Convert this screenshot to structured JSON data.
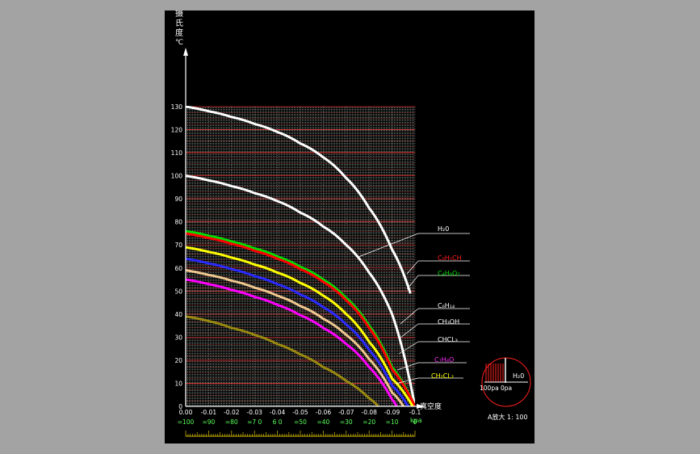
{
  "chart_data": {
    "type": "line",
    "title": "",
    "ylabel": "摄氏度 ℃",
    "xlabel": "真空度",
    "x_unit": "kpa",
    "xlim": [
      0,
      -0.1
    ],
    "ylim": [
      0,
      130
    ],
    "x_ticks": [
      "0.00",
      "-0.01",
      "-0.02",
      "-0.03",
      "-0.04",
      "-0.05",
      "-0.06",
      "-0.07",
      "-0.08",
      "-0.09",
      "-0.1"
    ],
    "x_ticks_secondary": [
      "=100",
      "=90",
      "=80",
      "≈7 0",
      "6 0",
      "=50",
      "=40",
      "=30",
      "=20",
      "=10",
      "0"
    ],
    "y_ticks": [
      "0",
      "10",
      "20",
      "30",
      "40",
      "50",
      "60",
      "70",
      "80",
      "90",
      "100",
      "110",
      "120",
      "130"
    ],
    "grid": true,
    "series": [
      {
        "name": "H2O",
        "label_text": "H₂0",
        "color": "#ffffff",
        "points": [
          [
            0,
            100
          ],
          [
            -0.01,
            98
          ],
          [
            -0.02,
            95.5
          ],
          [
            -0.03,
            92.5
          ],
          [
            -0.04,
            89
          ],
          [
            -0.05,
            84
          ],
          [
            -0.06,
            78
          ],
          [
            -0.07,
            70
          ],
          [
            -0.08,
            58
          ],
          [
            -0.09,
            40
          ],
          [
            -0.1,
            0
          ]
        ]
      },
      {
        "name": "C6H5CH",
        "label_text": "C₆H₅CH",
        "color": "#ffffff",
        "points": [
          [
            0,
            130
          ],
          [
            -0.01,
            128
          ],
          [
            -0.02,
            125.5
          ],
          [
            -0.03,
            122.5
          ],
          [
            -0.04,
            119
          ],
          [
            -0.05,
            114
          ],
          [
            -0.06,
            108
          ],
          [
            -0.07,
            99
          ],
          [
            -0.08,
            86
          ],
          [
            -0.09,
            68
          ],
          [
            -0.098,
            49
          ]
        ]
      },
      {
        "name": "C4H8O2",
        "label_text": "C₄H₈O₂",
        "color": "#00e000",
        "points": [
          [
            0,
            76
          ],
          [
            -0.01,
            74
          ],
          [
            -0.02,
            71.5
          ],
          [
            -0.03,
            68.5
          ],
          [
            -0.04,
            65
          ],
          [
            -0.05,
            60.5
          ],
          [
            -0.06,
            55
          ],
          [
            -0.07,
            47
          ],
          [
            -0.08,
            35
          ],
          [
            -0.09,
            17
          ],
          [
            -0.1,
            0
          ]
        ]
      },
      {
        "name": "C6H14",
        "label_text": "C₆H₁₄",
        "color": "#ff0000",
        "points": [
          [
            0,
            75
          ],
          [
            -0.01,
            73
          ],
          [
            -0.02,
            70.5
          ],
          [
            -0.03,
            67.5
          ],
          [
            -0.04,
            64
          ],
          [
            -0.05,
            59.5
          ],
          [
            -0.06,
            54
          ],
          [
            -0.07,
            46
          ],
          [
            -0.08,
            34
          ],
          [
            -0.09,
            16
          ],
          [
            -0.1,
            0
          ]
        ]
      },
      {
        "name": "CH3OH",
        "label_text": "CH₃OH",
        "color": "#ffff00",
        "points": [
          [
            0,
            69
          ],
          [
            -0.01,
            67
          ],
          [
            -0.02,
            64.5
          ],
          [
            -0.03,
            61.5
          ],
          [
            -0.04,
            58
          ],
          [
            -0.05,
            53.5
          ],
          [
            -0.06,
            48
          ],
          [
            -0.07,
            40
          ],
          [
            -0.08,
            28
          ],
          [
            -0.09,
            12
          ],
          [
            -0.099,
            0
          ]
        ]
      },
      {
        "name": "CHCL3",
        "label_text": "CHCL₃",
        "color": "#2a2aff",
        "points": [
          [
            0,
            64
          ],
          [
            -0.01,
            62
          ],
          [
            -0.02,
            59.5
          ],
          [
            -0.03,
            56.5
          ],
          [
            -0.04,
            53
          ],
          [
            -0.05,
            48.5
          ],
          [
            -0.06,
            43
          ],
          [
            -0.07,
            35.5
          ],
          [
            -0.08,
            24.5
          ],
          [
            -0.09,
            9
          ],
          [
            -0.097,
            0
          ]
        ]
      },
      {
        "name": "C7H8O",
        "label_text": "C₇H₈O",
        "color": "#f0c890",
        "points": [
          [
            0,
            59
          ],
          [
            -0.01,
            57
          ],
          [
            -0.02,
            54.5
          ],
          [
            -0.03,
            51.5
          ],
          [
            -0.04,
            48
          ],
          [
            -0.05,
            43.5
          ],
          [
            -0.06,
            38
          ],
          [
            -0.07,
            31
          ],
          [
            -0.08,
            20.5
          ],
          [
            -0.09,
            6
          ],
          [
            -0.095,
            0
          ]
        ]
      },
      {
        "name": "CH2CL2",
        "label_text": "CH₂CL₂",
        "color": "#ff00ff",
        "points": [
          [
            0,
            55
          ],
          [
            -0.01,
            53
          ],
          [
            -0.02,
            50.5
          ],
          [
            -0.03,
            47.5
          ],
          [
            -0.04,
            44
          ],
          [
            -0.05,
            39.5
          ],
          [
            -0.06,
            34
          ],
          [
            -0.07,
            27
          ],
          [
            -0.08,
            17
          ],
          [
            -0.09,
            3
          ],
          [
            -0.092,
            0
          ]
        ]
      },
      {
        "name": "olive",
        "color": "#9a8a10",
        "points": [
          [
            0,
            39
          ],
          [
            -0.01,
            37
          ],
          [
            -0.02,
            34
          ],
          [
            -0.03,
            31
          ],
          [
            -0.04,
            27
          ],
          [
            -0.05,
            22.5
          ],
          [
            -0.06,
            17
          ],
          [
            -0.07,
            11
          ],
          [
            -0.08,
            3.5
          ],
          [
            -0.084,
            0
          ]
        ]
      }
    ],
    "annotations": [
      "真空度",
      "kpa",
      "A放大 1: 100",
      "100pa",
      "0pa",
      "H₂0"
    ]
  },
  "labels": {
    "ylabel_chars": [
      "摄",
      "氏",
      "度",
      "℃"
    ],
    "xlabel": "真空度",
    "x_unit": "kpa",
    "inset_caption": "A放大 1: 100",
    "inset_left": "100pa",
    "inset_right": "0pa",
    "inset_h2o": "H₂0"
  }
}
